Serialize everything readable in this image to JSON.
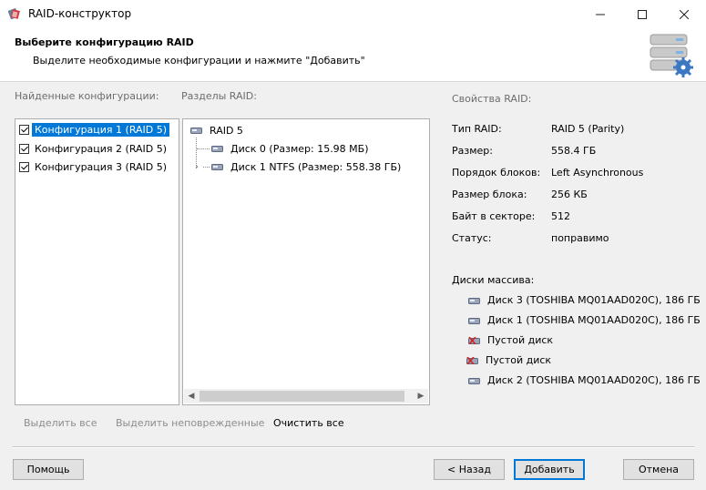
{
  "window": {
    "title": "RAID-конструктор",
    "minimize_glyph": "—",
    "maximize_glyph": "☐",
    "close_glyph": "✕"
  },
  "header": {
    "title": "Выберите конфигурацию RAID",
    "subtitle": "Выделите необходимые конфигурации и нажмите \"Добавить\""
  },
  "configs": {
    "label": "Найденные конфигурации:",
    "items": [
      {
        "label": "Конфигурация 1 (RAID 5)",
        "checked": true,
        "selected": true
      },
      {
        "label": "Конфигурация 2 (RAID 5)",
        "checked": true,
        "selected": false
      },
      {
        "label": "Конфигурация 3 (RAID 5)",
        "checked": true,
        "selected": false
      }
    ]
  },
  "partitions": {
    "label": "Разделы RAID:",
    "root": "RAID 5",
    "children": [
      {
        "label": "Диск 0 (Размер: 15.98 МБ)"
      },
      {
        "label": "Диск 1 NTFS (Размер: 558.38 ГБ)"
      }
    ]
  },
  "properties": {
    "label": "Свойства RAID:",
    "rows": [
      {
        "key": "Тип RAID:",
        "value": "RAID 5 (Parity)"
      },
      {
        "key": "Размер:",
        "value": "558.4 ГБ"
      },
      {
        "key": "Порядок блоков:",
        "value": "Left Asynchronous"
      },
      {
        "key": "Размер блока:",
        "value": "256 КБ"
      },
      {
        "key": "Байт в секторе:",
        "value": "512"
      },
      {
        "key": "Статус:",
        "value": "поправимо"
      }
    ],
    "disks_label": "Диски массива:",
    "disks": [
      {
        "label": "Диск 3 (TOSHIBA MQ01AAD020C), 186 ГБ",
        "icon": "disk-icon"
      },
      {
        "label": "Диск 1 (TOSHIBA MQ01AAD020C), 186 ГБ",
        "icon": "disk-icon"
      },
      {
        "label": "Пустой диск",
        "icon": "empty-disk-icon"
      },
      {
        "label": "Пустой диск",
        "icon": "empty-disk-icon"
      },
      {
        "label": "Диск 2 (TOSHIBA MQ01AAD020C), 186 ГБ",
        "icon": "disk-icon"
      }
    ]
  },
  "selection_links": {
    "select_all": "Выделить все",
    "select_intact": "Выделить неповрежденные",
    "clear_all": "Очистить все"
  },
  "buttons": {
    "help": "Помощь",
    "back": "< Назад",
    "add": "Добавить",
    "cancel": "Отмена"
  },
  "colors": {
    "selection": "#0078d7",
    "window_bg": "#f0f0f0",
    "disabled_text": "#8d8d8d"
  }
}
